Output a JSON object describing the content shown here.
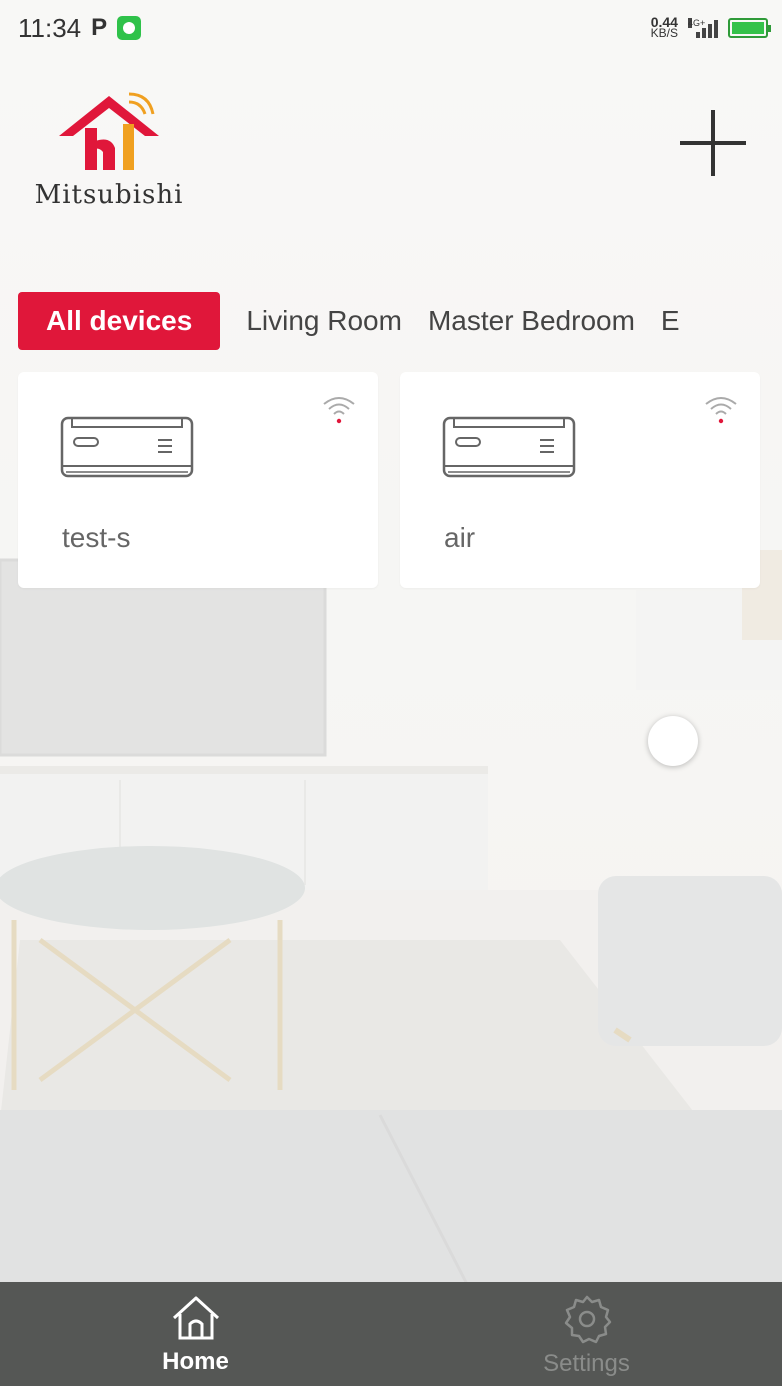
{
  "status_bar": {
    "time": "11:34",
    "p_label": "P",
    "net_speed_value": "0.44",
    "net_speed_unit": "KB/S",
    "network_tag": "4G+"
  },
  "app": {
    "logo_text": "Mitsubishi",
    "brand_color": "#e0173a"
  },
  "tabs": [
    {
      "label": "All devices",
      "active": true
    },
    {
      "label": "Living Room",
      "active": false
    },
    {
      "label": "Master Bedroom",
      "active": false
    },
    {
      "label": "E",
      "active": false
    }
  ],
  "devices": [
    {
      "name": "test-s",
      "icon": "air-conditioner-icon"
    },
    {
      "name": "air",
      "icon": "air-conditioner-icon"
    }
  ],
  "bottom_nav": [
    {
      "label": "Home",
      "icon": "home-icon",
      "active": true
    },
    {
      "label": "Settings",
      "icon": "gear-icon",
      "active": false
    }
  ]
}
